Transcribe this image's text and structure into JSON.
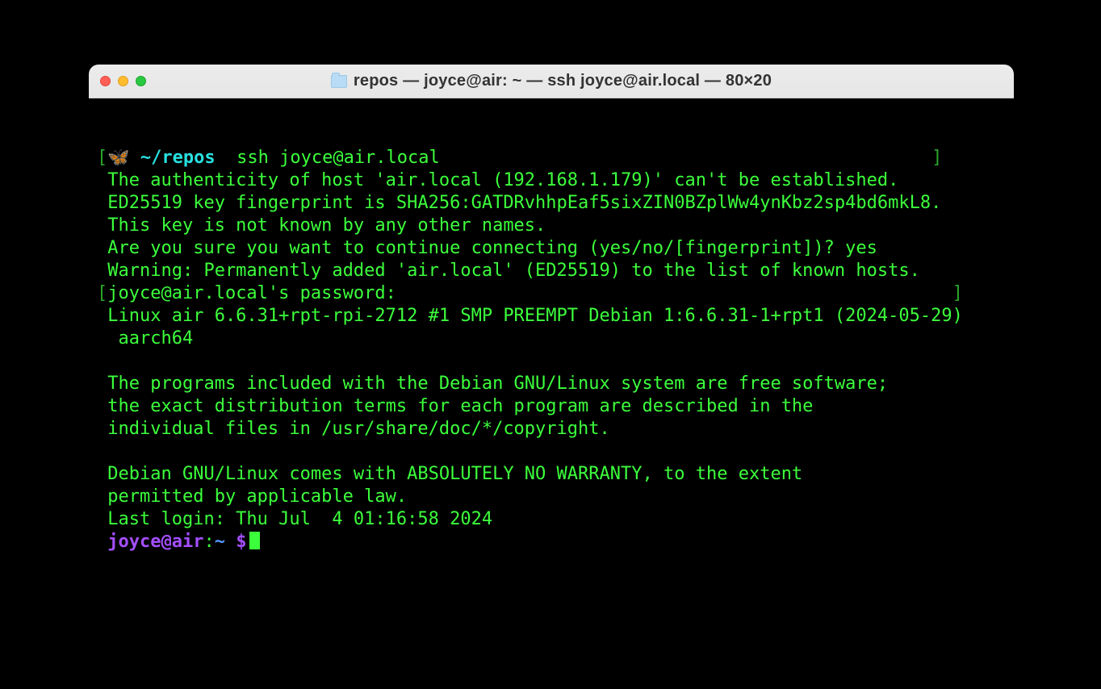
{
  "window": {
    "title": "repos — joyce@air: ~ — ssh joyce@air.local — 80×20"
  },
  "prompt1": {
    "lbracket": "[",
    "butterfly": "🦋",
    "cwd": " ~/repos ",
    "cmd": " ssh joyce@air.local",
    "rbracket": "]"
  },
  "lines": {
    "l0": " The authenticity of host 'air.local (192.168.1.179)' can't be established.",
    "l1": " ED25519 key fingerprint is SHA256:GATDRvhhpEaf5sixZIN0BZplWw4ynKbz2sp4bd6mkL8.",
    "l2": " This key is not known by any other names.",
    "l3": " Are you sure you want to continue connecting (yes/no/[fingerprint])? yes",
    "l4": " Warning: Permanently added 'air.local' (ED25519) to the list of known hosts.",
    "pw_lb": "[",
    "pw": "joyce@air.local's password:",
    "pw_rb": "]",
    "l5": " Linux air 6.6.31+rpt-rpi-2712 #1 SMP PREEMPT Debian 1:6.6.31-1+rpt1 (2024-05-29)",
    "l5b": "  aarch64",
    "blank": "",
    "l6": " The programs included with the Debian GNU/Linux system are free software;",
    "l7": " the exact distribution terms for each program are described in the",
    "l8": " individual files in /usr/share/doc/*/copyright.",
    "l9": " Debian GNU/Linux comes with ABSOLUTELY NO WARRANTY, to the extent",
    "l10": " permitted by applicable law.",
    "l11": " Last login: Thu Jul  4 01:16:58 2024"
  },
  "prompt2": {
    "userhost": " joyce@air",
    "colon": ":",
    "cwd": "~",
    "sp": " ",
    "dollar": "$"
  }
}
